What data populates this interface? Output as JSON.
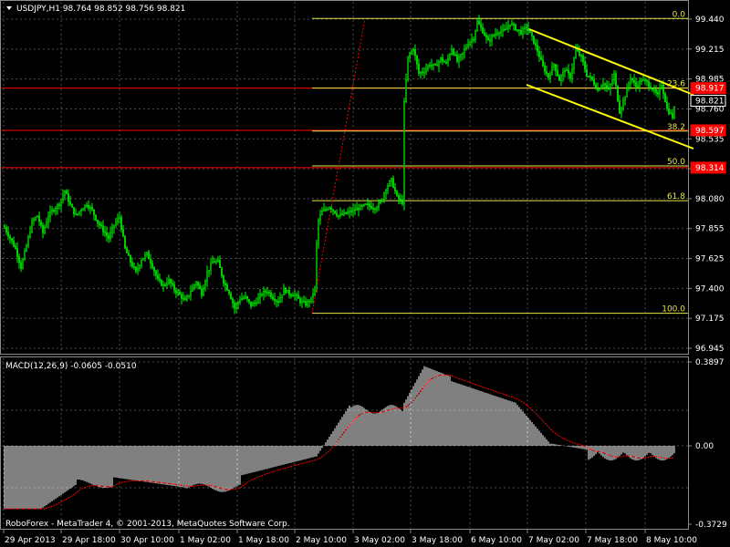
{
  "window": {
    "symbol_header": "USDJPY,H1  98.764 98.852 98.756 98.821",
    "footer": "RoboForex - MetaTrader 4, © 2001-2013, MetaQuotes Software Corp."
  },
  "colors": {
    "background": "#000000",
    "candle": "#00ff00",
    "grid": "#4d4d4d",
    "fibo": "#e6e64c",
    "channel": "#ffff00",
    "hline": "#ff0000",
    "macd_hist": "#ffffff",
    "macd_signal": "#ff0000"
  },
  "price_axis": {
    "ticks": [
      "99.440",
      "99.215",
      "98.985",
      "98.760",
      "98.535",
      "98.310",
      "98.080",
      "97.855",
      "97.625",
      "97.400",
      "97.175",
      "96.945"
    ]
  },
  "price_tags": [
    {
      "label": "98.917",
      "price": 98.917,
      "style": "red"
    },
    {
      "label": "98.821",
      "price": 98.821,
      "style": "white"
    },
    {
      "label": "98.597",
      "price": 98.597,
      "style": "red"
    },
    {
      "label": "98.314",
      "price": 98.314,
      "style": "red"
    }
  ],
  "horizontal_lines": [
    98.917,
    98.597,
    98.314
  ],
  "fibonacci": {
    "high": 99.445,
    "low": 97.21,
    "levels": [
      {
        "label": "0.0",
        "ratio": 0
      },
      {
        "label": "23.6",
        "ratio": 0.236
      },
      {
        "label": "38.2",
        "ratio": 0.382
      },
      {
        "label": "50.0",
        "ratio": 0.5
      },
      {
        "label": "61.8",
        "ratio": 0.618
      },
      {
        "label": "100.0",
        "ratio": 1
      }
    ]
  },
  "time_axis": {
    "labels": [
      "29 Apr 2013",
      "29 Apr 18:00",
      "30 Apr 10:00",
      "1 May 02:00",
      "1 May 18:00",
      "2 May 10:00",
      "3 May 02:00",
      "3 May 18:00",
      "6 May 10:00",
      "7 May 02:00",
      "7 May 18:00",
      "8 May 10:00"
    ]
  },
  "macd": {
    "label": "MACD(12,26,9) -0.0605 -0.0510",
    "axis_ticks": [
      "0.3897",
      "0.00",
      "-0.3729"
    ],
    "max": 0.3897,
    "min": -0.3729
  },
  "chart_data": {
    "type": "candlestick",
    "series": [
      {
        "name": "USDJPY,H1",
        "anchors_close": [
          [
            0,
            97.86
          ],
          [
            6,
            97.78
          ],
          [
            12,
            97.7
          ],
          [
            18,
            97.56
          ],
          [
            24,
            97.72
          ],
          [
            30,
            97.9
          ],
          [
            36,
            97.95
          ],
          [
            42,
            97.82
          ],
          [
            48,
            97.95
          ],
          [
            54,
            98.0
          ],
          [
            60,
            98.04
          ],
          [
            66,
            98.14
          ],
          [
            72,
            98.03
          ],
          [
            78,
            97.95
          ],
          [
            84,
            98.0
          ],
          [
            90,
            98.04
          ],
          [
            96,
            97.99
          ],
          [
            102,
            97.9
          ],
          [
            108,
            97.84
          ],
          [
            114,
            97.78
          ],
          [
            120,
            97.88
          ],
          [
            126,
            97.94
          ],
          [
            132,
            97.7
          ],
          [
            138,
            97.6
          ],
          [
            144,
            97.52
          ],
          [
            150,
            97.62
          ],
          [
            156,
            97.66
          ],
          [
            162,
            97.57
          ],
          [
            168,
            97.46
          ],
          [
            174,
            97.42
          ],
          [
            180,
            97.46
          ],
          [
            186,
            97.39
          ],
          [
            192,
            97.35
          ],
          [
            198,
            97.3
          ],
          [
            204,
            97.38
          ],
          [
            210,
            97.45
          ],
          [
            216,
            97.36
          ],
          [
            222,
            97.52
          ],
          [
            228,
            97.6
          ],
          [
            234,
            97.6
          ],
          [
            240,
            97.45
          ],
          [
            246,
            97.37
          ],
          [
            252,
            97.25
          ],
          [
            258,
            97.32
          ],
          [
            264,
            97.33
          ],
          [
            270,
            97.27
          ],
          [
            276,
            97.3
          ],
          [
            282,
            97.36
          ],
          [
            288,
            97.38
          ],
          [
            294,
            97.33
          ],
          [
            300,
            97.3
          ],
          [
            306,
            97.39
          ],
          [
            312,
            97.36
          ],
          [
            318,
            97.35
          ],
          [
            324,
            97.3
          ],
          [
            330,
            97.28
          ],
          [
            336,
            97.32
          ],
          [
            340,
            97.4
          ],
          [
            343,
            97.9
          ],
          [
            348,
            97.98
          ],
          [
            356,
            98.02
          ],
          [
            366,
            97.95
          ],
          [
            376,
            97.97
          ],
          [
            386,
            98.0
          ],
          [
            396,
            98.03
          ],
          [
            406,
            98.01
          ],
          [
            412,
            98.05
          ],
          [
            418,
            98.16
          ],
          [
            424,
            98.22
          ],
          [
            430,
            98.09
          ],
          [
            436,
            98.05
          ],
          [
            438,
            98.8
          ],
          [
            442,
            99.15
          ],
          [
            448,
            99.22
          ],
          [
            454,
            99.03
          ],
          [
            460,
            99.05
          ],
          [
            466,
            99.1
          ],
          [
            472,
            99.08
          ],
          [
            478,
            99.14
          ],
          [
            484,
            99.1
          ],
          [
            490,
            99.22
          ],
          [
            496,
            99.12
          ],
          [
            502,
            99.18
          ],
          [
            508,
            99.26
          ],
          [
            514,
            99.3
          ],
          [
            518,
            99.42
          ],
          [
            524,
            99.35
          ],
          [
            530,
            99.27
          ],
          [
            536,
            99.32
          ],
          [
            542,
            99.35
          ],
          [
            548,
            99.35
          ],
          [
            554,
            99.41
          ],
          [
            560,
            99.37
          ],
          [
            566,
            99.34
          ],
          [
            572,
            99.38
          ],
          [
            578,
            99.3
          ],
          [
            584,
            99.2
          ],
          [
            590,
            99.08
          ],
          [
            596,
            99.0
          ],
          [
            602,
            99.1
          ],
          [
            608,
            98.98
          ],
          [
            614,
            99.06
          ],
          [
            620,
            99.0
          ],
          [
            626,
            99.21
          ],
          [
            632,
            99.15
          ],
          [
            638,
            99.02
          ],
          [
            644,
            98.98
          ],
          [
            650,
            98.9
          ],
          [
            656,
            98.96
          ],
          [
            662,
            98.9
          ],
          [
            668,
            99.02
          ],
          [
            674,
            98.74
          ],
          [
            680,
            98.86
          ],
          [
            686,
            99.0
          ],
          [
            692,
            98.93
          ],
          [
            698,
            98.98
          ],
          [
            704,
            98.96
          ],
          [
            710,
            98.91
          ],
          [
            716,
            98.86
          ],
          [
            720,
            98.95
          ],
          [
            726,
            98.76
          ],
          [
            732,
            98.7
          ],
          [
            736,
            98.82
          ]
        ]
      }
    ]
  }
}
